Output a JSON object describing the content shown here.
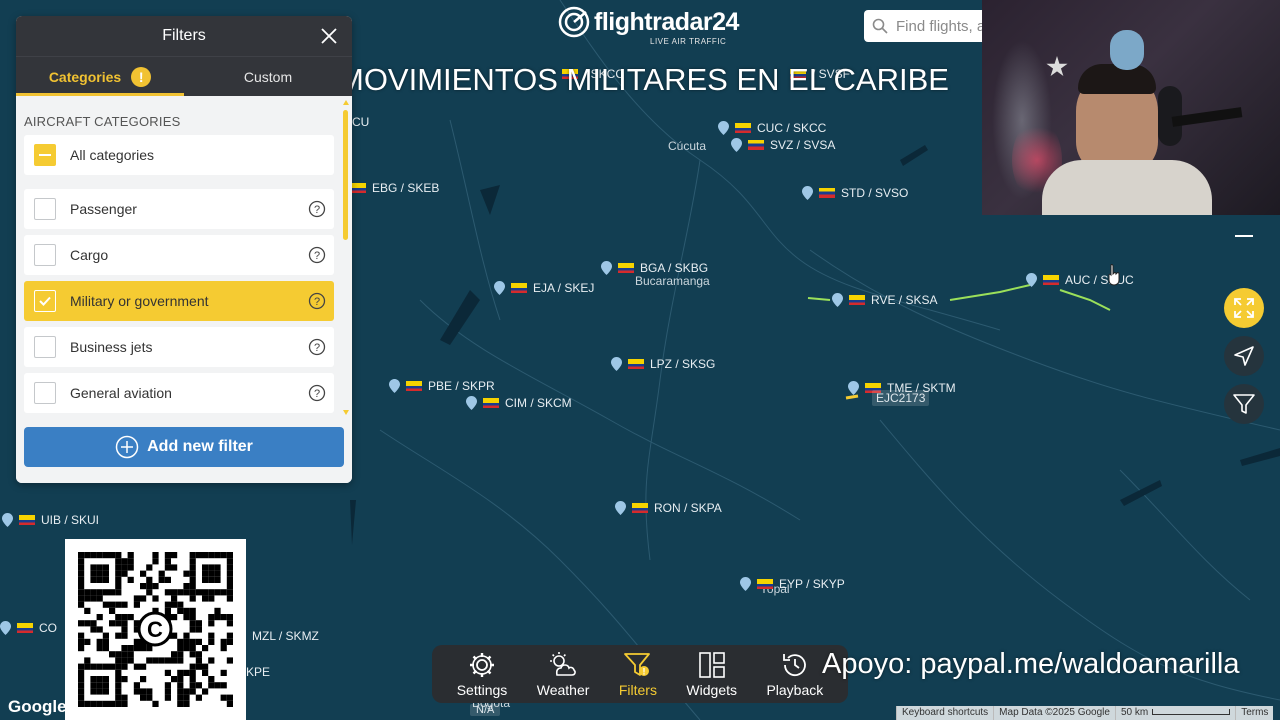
{
  "app": {
    "logo": "flightradar24",
    "logo_subtitle": "LIVE AIR TRAFFIC"
  },
  "search": {
    "placeholder": "Find flights, a"
  },
  "overlay_title": "MOVIMIENTOS MILITARES EN EL CARIBE",
  "support_text": "Apoyo: paypal.me/waldoamarilla",
  "filters": {
    "title": "Filters",
    "tabs": [
      {
        "label": "Categories",
        "warning": "!"
      },
      {
        "label": "Custom"
      }
    ],
    "section_label": "AIRCRAFT CATEGORIES",
    "all_label": "All categories",
    "categories": [
      {
        "label": "Passenger",
        "checked": false
      },
      {
        "label": "Cargo",
        "checked": false
      },
      {
        "label": "Military or government",
        "checked": true
      },
      {
        "label": "Business jets",
        "checked": false
      },
      {
        "label": "General aviation",
        "checked": false
      }
    ],
    "add_button": "Add new filter"
  },
  "map": {
    "airports": [
      {
        "code": "CUC / SKCC"
      },
      {
        "code": "SVZ / SVSA"
      },
      {
        "code": "STD / SVSO"
      },
      {
        "code": "EBG / SKEB"
      },
      {
        "code": "BGA / SKBG"
      },
      {
        "code": "EJA / SKEJ"
      },
      {
        "code": "RVE / SKSA"
      },
      {
        "code": "AUC / SKUC"
      },
      {
        "code": "LPZ / SKSG"
      },
      {
        "code": "TME / SKTM"
      },
      {
        "code": "PBE / SKPR"
      },
      {
        "code": "CIM / SKCM"
      },
      {
        "code": "RON / SKPA"
      },
      {
        "code": "EYP / SKYP"
      },
      {
        "code": "UIB / SKUI"
      },
      {
        "code": "MZL / SKMZ"
      },
      {
        "code": "CO"
      },
      {
        "code": "KPE"
      },
      {
        "code": "/ SKCC"
      },
      {
        "code": "/ SVSF"
      },
      {
        "code": "CU"
      }
    ],
    "cities": [
      "Cúcuta",
      "Bucaramanga",
      "Yopal",
      "Bogota"
    ],
    "flight_tag": "EJC2173",
    "na_label": "N/A"
  },
  "toolbar": [
    {
      "label": "Settings",
      "icon": "gear-icon"
    },
    {
      "label": "Weather",
      "icon": "weather-icon"
    },
    {
      "label": "Filters",
      "icon": "filter-icon",
      "active": true
    },
    {
      "label": "Widgets",
      "icon": "widgets-icon"
    },
    {
      "label": "Playback",
      "icon": "playback-icon"
    }
  ],
  "attribution": {
    "google": "Google",
    "shortcuts": "Keyboard shortcuts",
    "map_data": "Map Data ©2025 Google",
    "scale": "50 km",
    "terms": "Terms"
  },
  "colors": {
    "map_bg": "#123e52",
    "accent": "#f5cb32",
    "panel_header": "#33353a",
    "button_blue": "#3a7fc4"
  }
}
